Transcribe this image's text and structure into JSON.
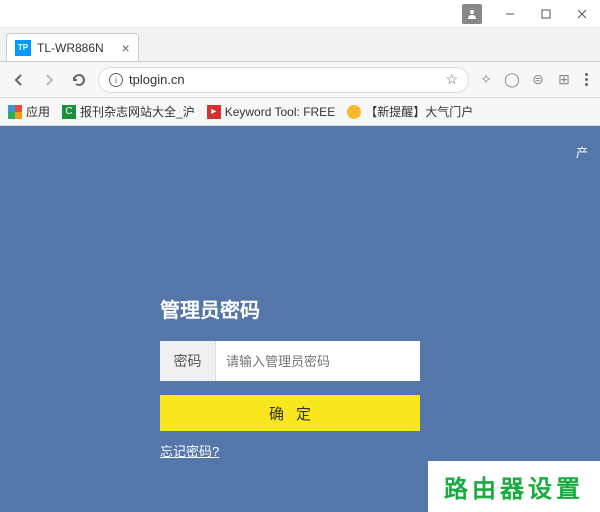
{
  "window": {
    "favicon_text": "TP"
  },
  "tab": {
    "title": "TL-WR886N"
  },
  "addressbar": {
    "url": "tplogin.cn"
  },
  "bookmarks": {
    "apps": "应用",
    "item1": "报刊杂志网站大全_沪",
    "item2": "Keyword Tool: FREE",
    "item3": "【新提醒】大气门户"
  },
  "page": {
    "corner": "产",
    "title": "管理员密码",
    "input_label": "密码",
    "input_placeholder": "请输入管理员密码",
    "submit": "确定",
    "forgot": "忘记密码?"
  },
  "watermark": "路由器设置"
}
